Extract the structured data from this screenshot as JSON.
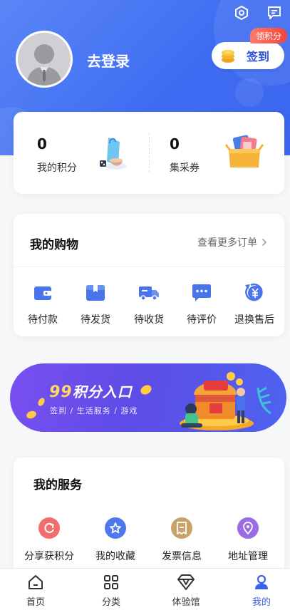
{
  "header": {
    "login_text": "去登录",
    "checkin_label": "签到",
    "badge_text": "领积分",
    "settings_icon": "settings-hexagon-icon",
    "message_icon": "message-icon"
  },
  "points": {
    "my_points_value": "0",
    "my_points_label": "我的积分",
    "coupons_value": "0",
    "coupons_label": "集采券"
  },
  "shopping": {
    "title": "我的购物",
    "more_label": "查看更多订单",
    "items": [
      {
        "label": "待付款",
        "icon": "wallet-icon"
      },
      {
        "label": "待发货",
        "icon": "package-icon"
      },
      {
        "label": "待收货",
        "icon": "truck-icon"
      },
      {
        "label": "待评价",
        "icon": "comment-icon"
      },
      {
        "label": "退换售后",
        "icon": "refund-yuan-icon"
      }
    ]
  },
  "banner": {
    "prefix": "99",
    "title": "积分入口",
    "subtitle": "签到 / 生活服务 / 游戏"
  },
  "services": {
    "title": "我的服务",
    "items": [
      {
        "label": "分享获积分",
        "icon": "share-icon",
        "color": "#f26d6d"
      },
      {
        "label": "我的收藏",
        "icon": "star-icon",
        "color": "#4d78ee"
      },
      {
        "label": "发票信息",
        "icon": "invoice-icon",
        "color": "#c9a26a"
      },
      {
        "label": "地址管理",
        "icon": "location-icon",
        "color": "#9b6be6"
      }
    ]
  },
  "tabbar": {
    "items": [
      {
        "label": "首页",
        "icon": "home-icon"
      },
      {
        "label": "分类",
        "icon": "category-icon"
      },
      {
        "label": "体验馆",
        "icon": "diamond-icon"
      },
      {
        "label": "我的",
        "icon": "user-icon",
        "active": true
      }
    ]
  },
  "colors": {
    "primary": "#3e6cf2",
    "accent": "#3a62e8",
    "badge": "#f2453d"
  }
}
